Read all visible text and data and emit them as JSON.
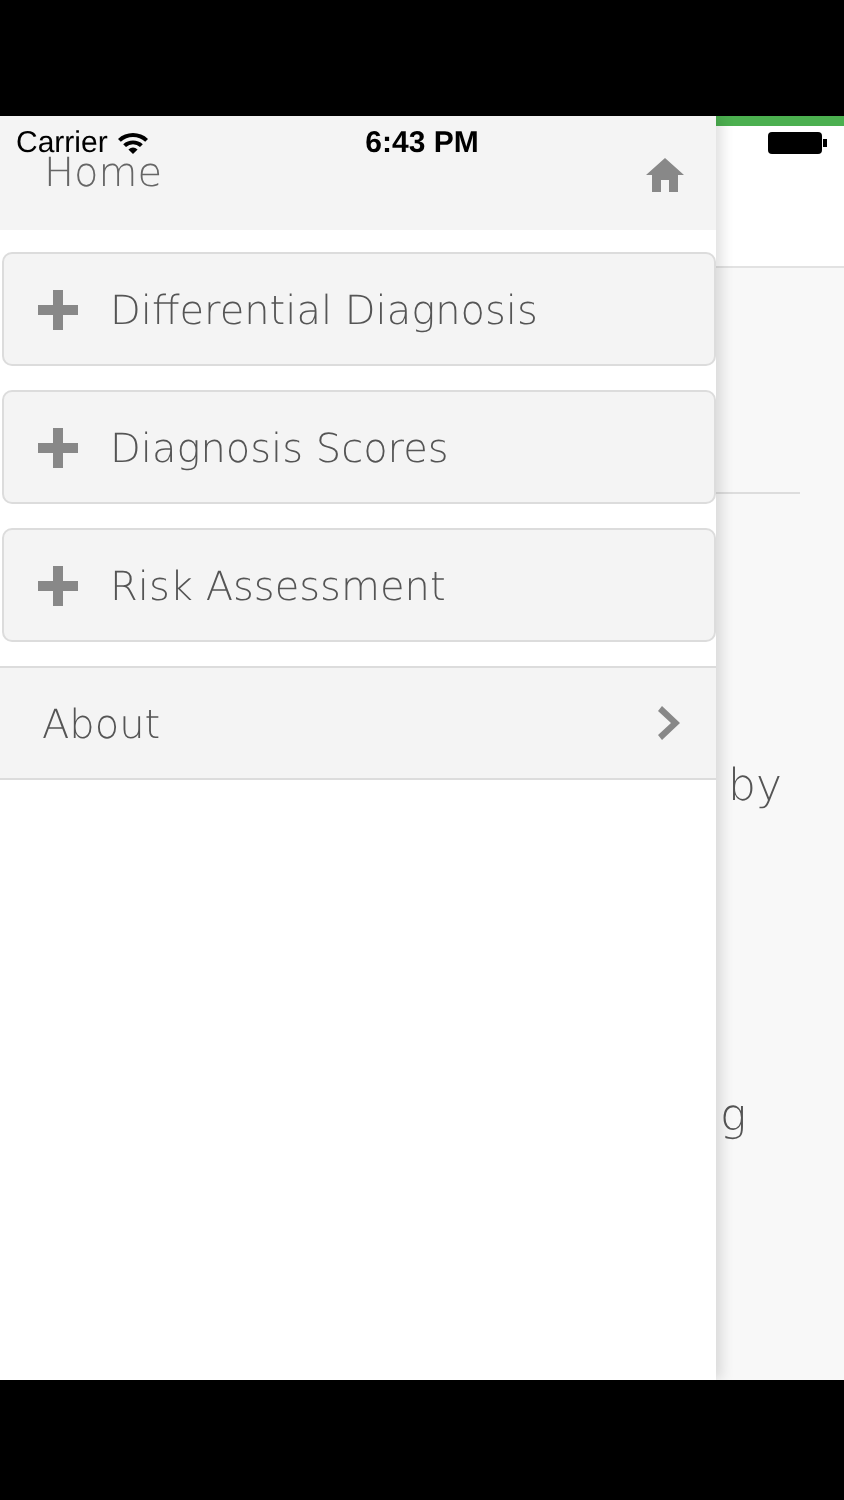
{
  "status_bar": {
    "carrier": "Carrier",
    "time": "6:43 PM"
  },
  "drawer": {
    "title": "Home",
    "items": [
      {
        "label": "Differential Diagnosis",
        "kind": "expandable"
      },
      {
        "label": "Diagnosis Scores",
        "kind": "expandable"
      },
      {
        "label": "Risk Assessment",
        "kind": "expandable"
      },
      {
        "label": "About",
        "kind": "link"
      }
    ]
  },
  "background_page": {
    "texts": [
      "by",
      "g"
    ]
  }
}
